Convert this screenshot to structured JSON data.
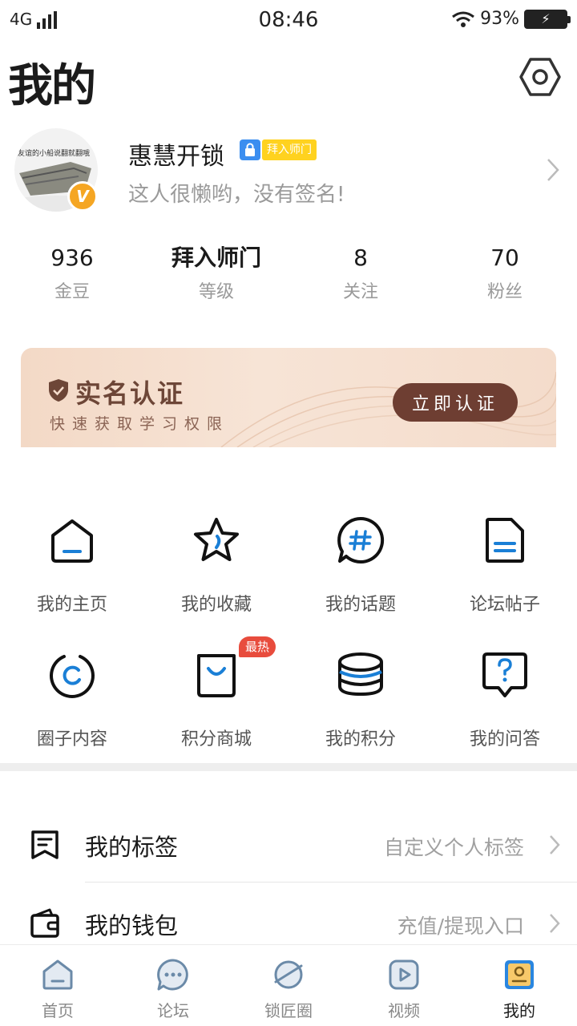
{
  "status_bar": {
    "network": "4G",
    "time": "08:46",
    "battery": "93%"
  },
  "header": {
    "title": "我的",
    "settings_icon": "hexagon-settings-icon"
  },
  "profile": {
    "avatar_caption": "友谊的小船说翻就翻哦",
    "badge_letter": "V",
    "name": "惠慧开锁",
    "level_tag": "拜入师门",
    "signature": "这人很懒哟，没有签名!"
  },
  "stats": [
    {
      "value": "936",
      "label": "金豆"
    },
    {
      "value": "拜入师门",
      "label": "等级"
    },
    {
      "value": "8",
      "label": "关注"
    },
    {
      "value": "70",
      "label": "粉丝"
    }
  ],
  "verify_banner": {
    "title": "实名认证",
    "subtitle": "快速获取学习权限",
    "button": "立即认证"
  },
  "grid": [
    {
      "label": "我的主页",
      "icon": "home-icon"
    },
    {
      "label": "我的收藏",
      "icon": "star-icon"
    },
    {
      "label": "我的话题",
      "icon": "topic-hash-icon"
    },
    {
      "label": "论坛帖子",
      "icon": "document-icon"
    },
    {
      "label": "圈子内容",
      "icon": "circle-icon"
    },
    {
      "label": "积分商城",
      "icon": "shopping-bag-icon",
      "tag": "最热"
    },
    {
      "label": "我的积分",
      "icon": "coins-stack-icon"
    },
    {
      "label": "我的问答",
      "icon": "question-bubble-icon"
    }
  ],
  "list": [
    {
      "label": "我的标签",
      "hint": "自定义个人标签",
      "icon": "tag-note-icon"
    },
    {
      "label": "我的钱包",
      "hint": "充值/提现入口",
      "icon": "wallet-icon"
    }
  ],
  "bottom_nav": [
    {
      "label": "首页",
      "icon": "home-nav-icon",
      "active": false
    },
    {
      "label": "论坛",
      "icon": "chat-nav-icon",
      "active": false
    },
    {
      "label": "锁匠圈",
      "icon": "planet-nav-icon",
      "active": false
    },
    {
      "label": "视频",
      "icon": "video-nav-icon",
      "active": false
    },
    {
      "label": "我的",
      "icon": "profile-nav-icon",
      "active": true
    }
  ],
  "colors": {
    "accent_blue": "#1a7fd6",
    "brand_brown": "#6e3e32",
    "hot_red": "#e84c3d",
    "tag_yellow": "#ffd21f"
  }
}
